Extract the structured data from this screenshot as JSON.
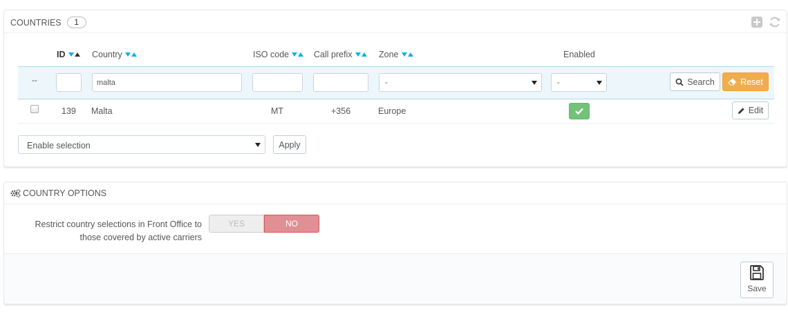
{
  "countries_panel": {
    "title": "COUNTRIES",
    "count": "1",
    "toolbar": {
      "add_icon": "plus-square-icon",
      "refresh_icon": "refresh-icon"
    },
    "columns": {
      "id": "ID",
      "country": "Country",
      "iso": "ISO code",
      "prefix": "Call prefix",
      "zone": "Zone",
      "enabled": "Enabled"
    },
    "filters": {
      "bulk_placeholder": "--",
      "id_value": "",
      "country_value": "malta",
      "iso_value": "",
      "prefix_value": "",
      "zone_selected": "-",
      "enabled_selected": "-",
      "search_label": "Search",
      "reset_label": "Reset"
    },
    "rows": [
      {
        "id": "139",
        "country": "Malta",
        "iso": "MT",
        "prefix": "+356",
        "zone": "Europe",
        "enabled": true,
        "edit_label": "Edit"
      }
    ],
    "bulk_action": {
      "selected": "Enable selection",
      "apply_label": "Apply"
    }
  },
  "options_panel": {
    "title": "COUNTRY OPTIONS",
    "restrict_label": "Restrict country selections in Front Office to those covered by active carriers",
    "switch": {
      "yes": "YES",
      "no": "NO",
      "selected": "NO"
    },
    "save_label": "Save"
  },
  "colors": {
    "accent": "#00aff0",
    "filter_bg": "#ecf6fb",
    "reset": "#f0ad4e",
    "enabled_green": "#72c279",
    "no_red": "#e08f95"
  }
}
